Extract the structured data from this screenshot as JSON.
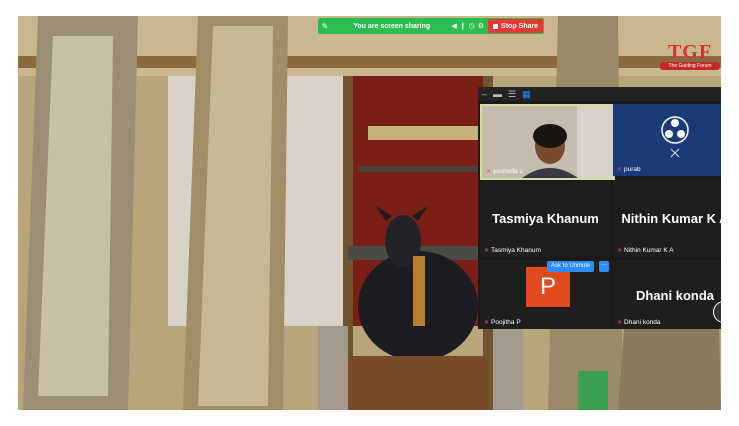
{
  "share_bar": {
    "message": "You are screen sharing",
    "stop_label": "Stop Share",
    "icons": [
      "pin-icon",
      "volume-icon",
      "mic-icon",
      "timer-icon",
      "gear-icon"
    ]
  },
  "logo": {
    "text": "TGF",
    "tagline": "The Guiding Forum"
  },
  "gallery": {
    "toolbar_icons": [
      "minimize-icon",
      "single-view-icon",
      "strip-view-icon",
      "gallery-view-icon"
    ],
    "participants": [
      {
        "name": "yeshoda s",
        "muted": true,
        "video": true
      },
      {
        "name": "purab",
        "muted": true,
        "video": false,
        "icon": "obs-logo-icon"
      },
      {
        "name": "Tasmiya Khanum",
        "display": "Tasmiya Khanum",
        "muted": true
      },
      {
        "name": "Nithin Kumar K A",
        "display": "Nithin Kumar K A",
        "muted": true
      },
      {
        "name": "Poojitha P",
        "avatar_letter": "P",
        "muted": true
      },
      {
        "name": "Dhani konda",
        "display": "Dhani konda",
        "muted": true
      }
    ],
    "ask_unmute_label": "Ask to Unmute",
    "more_label": "···",
    "next_label": "›"
  },
  "colors": {
    "share_green": "#2bbd52",
    "stop_red": "#e53935",
    "zoom_blue": "#2d8cff",
    "avatar_orange": "#e04a1f"
  }
}
